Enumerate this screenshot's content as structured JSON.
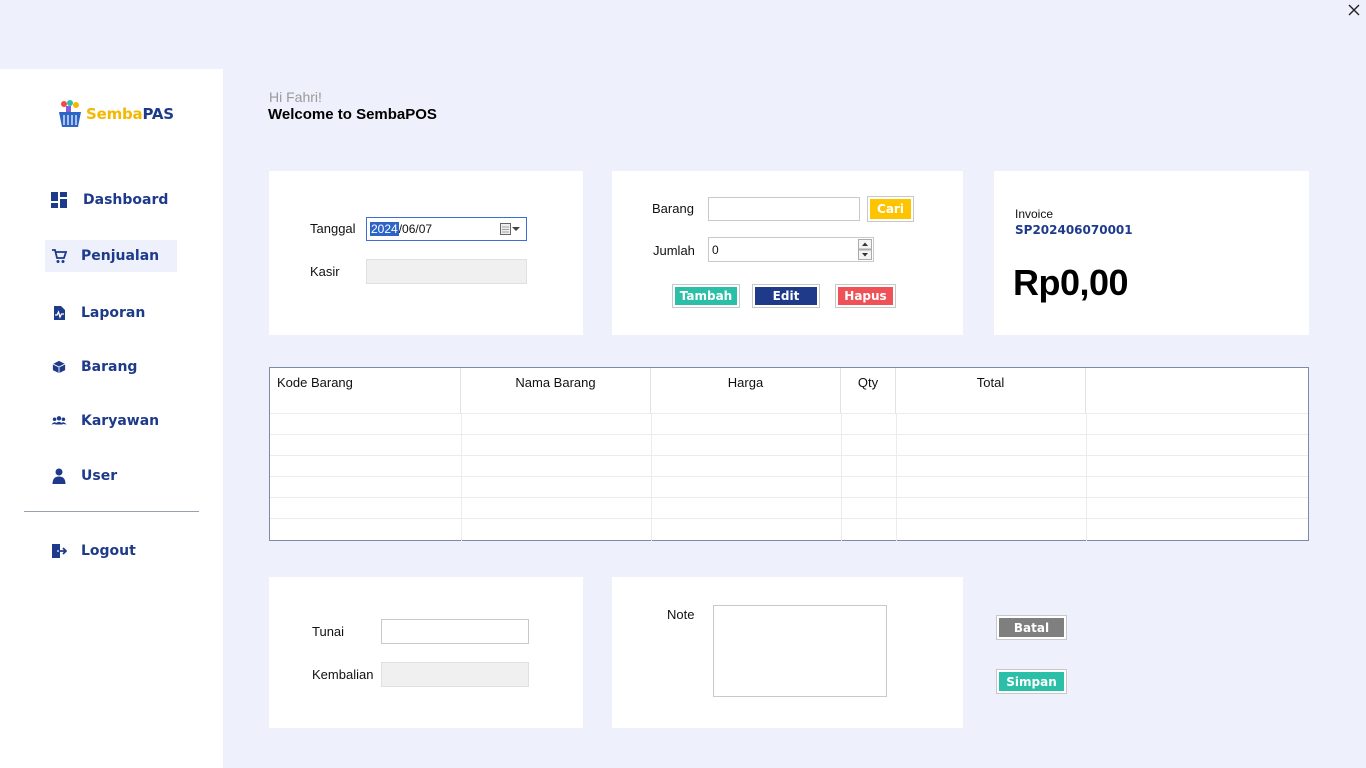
{
  "app": {
    "logo_part1": "Semba",
    "logo_part2": "PAS"
  },
  "sidebar": {
    "items": [
      {
        "label": "Dashboard",
        "icon": "dashboard-icon"
      },
      {
        "label": "Penjualan",
        "icon": "cart-icon",
        "active": true
      },
      {
        "label": "Laporan",
        "icon": "report-icon"
      },
      {
        "label": "Barang",
        "icon": "box-icon"
      },
      {
        "label": "Karyawan",
        "icon": "users-icon"
      },
      {
        "label": "User",
        "icon": "user-icon"
      }
    ],
    "logout": {
      "label": "Logout",
      "icon": "logout-icon"
    }
  },
  "header": {
    "greeting": "Hi Fahri!",
    "welcome": "Welcome to SembaPOS"
  },
  "form_left": {
    "tanggal_label": "Tanggal",
    "tanggal_selected": "2024",
    "tanggal_rest": "/06/07",
    "kasir_label": "Kasir",
    "kasir_value": ""
  },
  "form_mid": {
    "barang_label": "Barang",
    "barang_value": "",
    "cari_label": "Cari",
    "jumlah_label": "Jumlah",
    "jumlah_value": "0",
    "tambah_label": "Tambah",
    "edit_label": "Edit",
    "hapus_label": "Hapus"
  },
  "invoice": {
    "label": "Invoice",
    "number": "SP202406070001",
    "total": "Rp0,00"
  },
  "table": {
    "columns": [
      "Kode Barang",
      "Nama Barang",
      "Harga",
      "Qty",
      "Total",
      ""
    ],
    "rows": []
  },
  "payment": {
    "tunai_label": "Tunai",
    "tunai_value": "",
    "kembalian_label": "Kembalian",
    "kembalian_value": ""
  },
  "note": {
    "label": "Note",
    "value": ""
  },
  "actions": {
    "batal_label": "Batal",
    "simpan_label": "Simpan"
  },
  "colors": {
    "brand_blue": "#1e3a8a",
    "brand_yellow": "#f5b800",
    "tambah": "#2bbfa8",
    "edit": "#203a8a",
    "hapus": "#ef5158",
    "cari": "#ffc400",
    "batal": "#7f7f7f",
    "simpan": "#2bbfa8"
  }
}
